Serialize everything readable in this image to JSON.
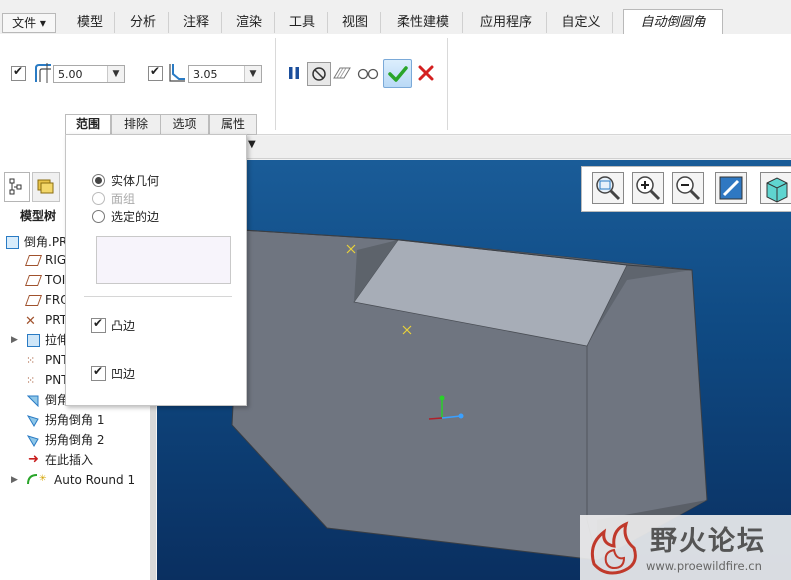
{
  "ribbon_tabs": [
    "文件",
    "模型",
    "分析",
    "注释",
    "渲染",
    "工具",
    "视图",
    "柔性建模",
    "应用程序",
    "自定义",
    "自动倒圆角"
  ],
  "dashboard": {
    "value1": "5.00",
    "value2": "3.05",
    "tabs": [
      "范围",
      "排除",
      "选项",
      "属性"
    ]
  },
  "popup": {
    "options": [
      {
        "label": "实体几何",
        "selected": true,
        "disabled": false
      },
      {
        "label": "面组",
        "selected": false,
        "disabled": true
      },
      {
        "label": "选定的边",
        "selected": false,
        "disabled": false
      }
    ],
    "check1": "凸边",
    "check2": "凹边"
  },
  "tree": {
    "title": "模型树",
    "items": [
      {
        "label": "倒角.PR"
      },
      {
        "label": "RIG"
      },
      {
        "label": "TOI"
      },
      {
        "label": "FRO"
      },
      {
        "label": "PRT"
      },
      {
        "label": "拉伸"
      },
      {
        "label": "PNT"
      },
      {
        "label": "PNT"
      },
      {
        "label": "倒角"
      },
      {
        "label": "拐角倒角 1"
      },
      {
        "label": "拐角倒角 2"
      },
      {
        "label": "在此插入"
      },
      {
        "label": "Auto Round 1"
      }
    ]
  },
  "watermark": {
    "title": "野火论坛",
    "url": "www.proewildfire.cn"
  },
  "colors": {
    "viewport_bg": "#1a5c98",
    "part": "#6f7580",
    "part_top": "#a7adb7",
    "accept": "#2aa52a",
    "cancel": "#d42020",
    "watermark_red": "#c0392b"
  }
}
